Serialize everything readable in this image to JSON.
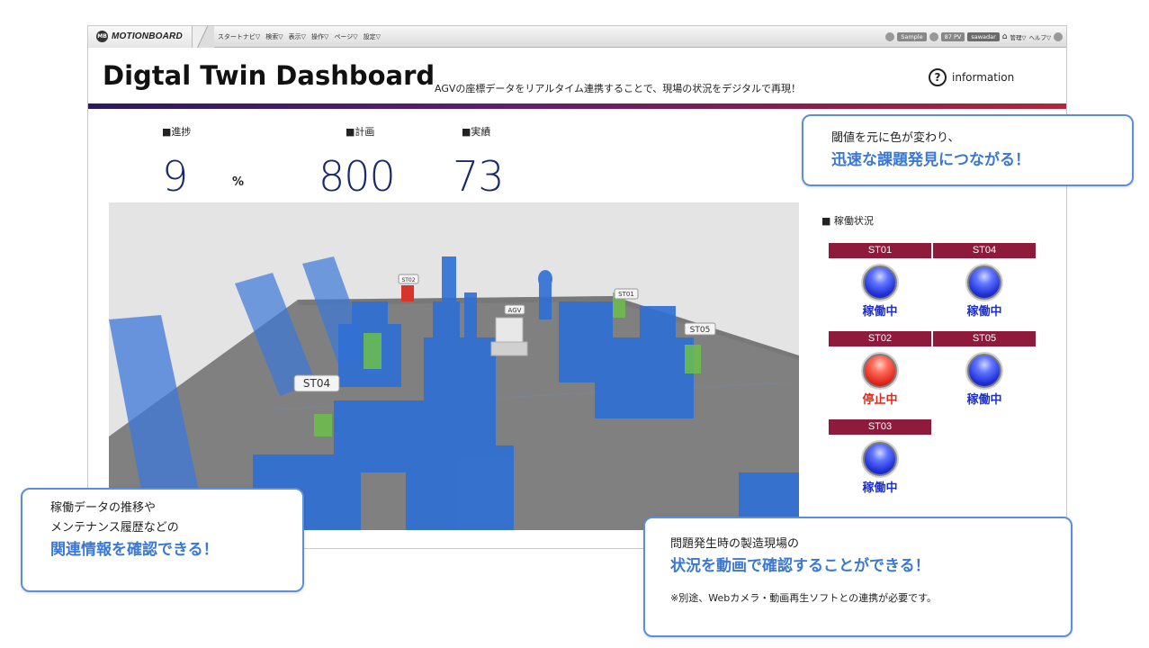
{
  "app": {
    "logo_badge": "MB",
    "logo_text": "MOTIONBOARD",
    "menu": [
      "スタートナビ▽",
      "検索▽",
      "表示▽",
      "操作▽",
      "ページ▽",
      "設定▽"
    ],
    "right": {
      "sample": "Sample",
      "pv": "87 PV",
      "user": "sawadar",
      "manage": "管理▽",
      "help": "ヘルプ▽"
    }
  },
  "header": {
    "title": "Digtal Twin Dashboard",
    "subtitle": "AGVの座標データをリアルタイム連携することで、現場の状況をデジタルで再現！",
    "info_icon": "?",
    "info_label": "information"
  },
  "kpis": {
    "progress": {
      "label": "■進捗",
      "value": "9",
      "unit": "%"
    },
    "plan": {
      "label": "■計画",
      "value": "800"
    },
    "actual": {
      "label": "■実績",
      "value": "73"
    }
  },
  "scene": {
    "tags": [
      "ST04",
      "AGV",
      "ST01",
      "ST05",
      "ST02"
    ]
  },
  "status": {
    "title": "■ 稼働状況",
    "stations": [
      {
        "id": "ST01",
        "state": "稼働中",
        "color": "#1c2fd6"
      },
      {
        "id": "ST04",
        "state": "稼働中",
        "color": "#1c2fd6"
      },
      {
        "id": "ST02",
        "state": "停止中",
        "color": "#e02a1a"
      },
      {
        "id": "ST05",
        "state": "稼働中",
        "color": "#1c2fd6"
      },
      {
        "id": "ST03",
        "state": "稼働中",
        "color": "#1c2fd6"
      }
    ]
  },
  "callouts": {
    "top_right": {
      "line1": "閾値を元に色が変わり、",
      "accent": "迅速な課題発見につながる！"
    },
    "bottom_left": {
      "line1": "稼働データの推移や",
      "line2": "メンテナンス履歴などの",
      "accent": "関連情報を確認できる！"
    },
    "bottom_right": {
      "line1": "問題発生時の製造現場の",
      "accent": "状況を動画で確認することができる！",
      "note": "※別途、Webカメラ・動画再生ソフトとの連携が必要です。"
    }
  }
}
